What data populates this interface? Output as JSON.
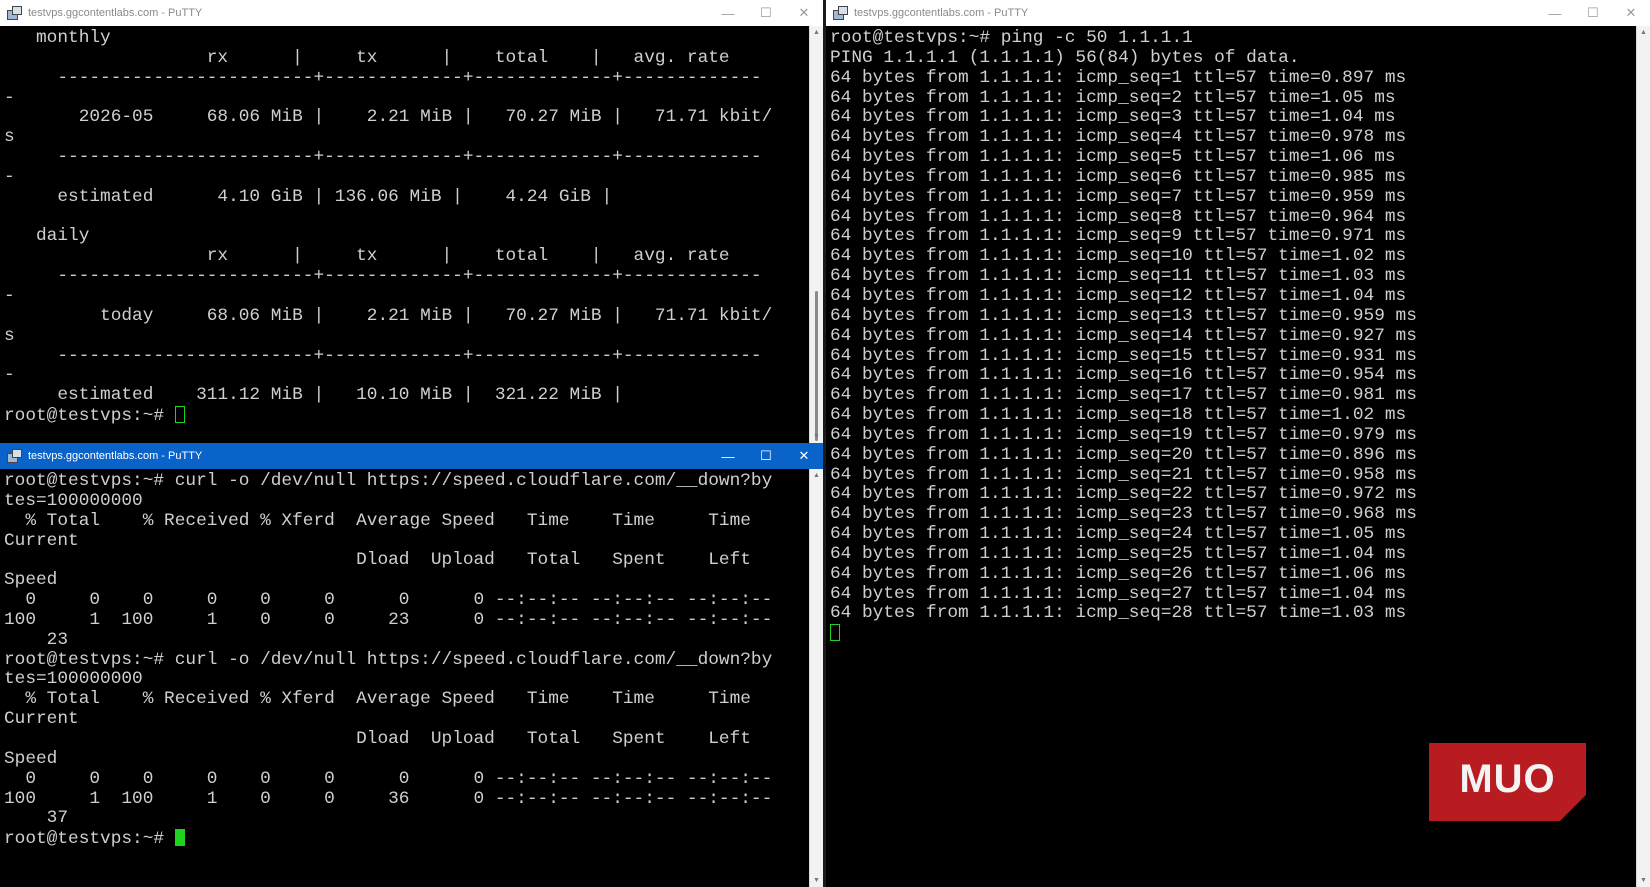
{
  "win_vnstat": {
    "title": "testvps.ggcontentlabs.com - PuTTY",
    "lines": [
      "   monthly",
      "                   rx      |     tx      |    total    |   avg. rate",
      "     ------------------------+-------------+-------------+-------------",
      "-",
      "       2026-05     68.06 MiB |    2.21 MiB |   70.27 MiB |   71.71 kbit/",
      "s",
      "     ------------------------+-------------+-------------+-------------",
      "-",
      "     estimated      4.10 GiB | 136.06 MiB |    4.24 GiB |",
      "",
      "   daily",
      "                   rx      |     tx      |    total    |   avg. rate",
      "     ------------------------+-------------+-------------+-------------",
      "-",
      "         today     68.06 MiB |    2.21 MiB |   70.27 MiB |   71.71 kbit/",
      "s",
      "     ------------------------+-------------+-------------+-------------",
      "-",
      "     estimated    311.12 MiB |   10.10 MiB |  321.22 MiB |"
    ],
    "prompt": "root@testvps:~# "
  },
  "win_curl": {
    "title": "testvps.ggcontentlabs.com - PuTTY",
    "lines": [
      "root@testvps:~# curl -o /dev/null https://speed.cloudflare.com/__down?by",
      "tes=100000000",
      "  % Total    % Received % Xferd  Average Speed   Time    Time     Time",
      "Current",
      "                                 Dload  Upload   Total   Spent    Left",
      "Speed",
      "  0     0    0     0    0     0      0      0 --:--:-- --:--:-- --:--:--",
      "100     1  100     1    0     0     23      0 --:--:-- --:--:-- --:--:--",
      "    23",
      "root@testvps:~# curl -o /dev/null https://speed.cloudflare.com/__down?by",
      "tes=100000000",
      "  % Total    % Received % Xferd  Average Speed   Time    Time     Time",
      "Current",
      "                                 Dload  Upload   Total   Spent    Left",
      "Speed",
      "  0     0    0     0    0     0      0      0 --:--:-- --:--:-- --:--:--",
      "100     1  100     1    0     0     36      0 --:--:-- --:--:-- --:--:--",
      "    37"
    ],
    "prompt": "root@testvps:~# "
  },
  "win_ping": {
    "title": "testvps.ggcontentlabs.com - PuTTY",
    "lines": [
      "root@testvps:~# ping -c 50 1.1.1.1",
      "PING 1.1.1.1 (1.1.1.1) 56(84) bytes of data.",
      "64 bytes from 1.1.1.1: icmp_seq=1 ttl=57 time=0.897 ms",
      "64 bytes from 1.1.1.1: icmp_seq=2 ttl=57 time=1.05 ms",
      "64 bytes from 1.1.1.1: icmp_seq=3 ttl=57 time=1.04 ms",
      "64 bytes from 1.1.1.1: icmp_seq=4 ttl=57 time=0.978 ms",
      "64 bytes from 1.1.1.1: icmp_seq=5 ttl=57 time=1.06 ms",
      "64 bytes from 1.1.1.1: icmp_seq=6 ttl=57 time=0.985 ms",
      "64 bytes from 1.1.1.1: icmp_seq=7 ttl=57 time=0.959 ms",
      "64 bytes from 1.1.1.1: icmp_seq=8 ttl=57 time=0.964 ms",
      "64 bytes from 1.1.1.1: icmp_seq=9 ttl=57 time=0.971 ms",
      "64 bytes from 1.1.1.1: icmp_seq=10 ttl=57 time=1.02 ms",
      "64 bytes from 1.1.1.1: icmp_seq=11 ttl=57 time=1.03 ms",
      "64 bytes from 1.1.1.1: icmp_seq=12 ttl=57 time=1.04 ms",
      "64 bytes from 1.1.1.1: icmp_seq=13 ttl=57 time=0.959 ms",
      "64 bytes from 1.1.1.1: icmp_seq=14 ttl=57 time=0.927 ms",
      "64 bytes from 1.1.1.1: icmp_seq=15 ttl=57 time=0.931 ms",
      "64 bytes from 1.1.1.1: icmp_seq=16 ttl=57 time=0.954 ms",
      "64 bytes from 1.1.1.1: icmp_seq=17 ttl=57 time=0.981 ms",
      "64 bytes from 1.1.1.1: icmp_seq=18 ttl=57 time=1.02 ms",
      "64 bytes from 1.1.1.1: icmp_seq=19 ttl=57 time=0.979 ms",
      "64 bytes from 1.1.1.1: icmp_seq=20 ttl=57 time=0.896 ms",
      "64 bytes from 1.1.1.1: icmp_seq=21 ttl=57 time=0.958 ms",
      "64 bytes from 1.1.1.1: icmp_seq=22 ttl=57 time=0.972 ms",
      "64 bytes from 1.1.1.1: icmp_seq=23 ttl=57 time=0.968 ms",
      "64 bytes from 1.1.1.1: icmp_seq=24 ttl=57 time=1.05 ms",
      "64 bytes from 1.1.1.1: icmp_seq=25 ttl=57 time=1.04 ms",
      "64 bytes from 1.1.1.1: icmp_seq=26 ttl=57 time=1.06 ms",
      "64 bytes from 1.1.1.1: icmp_seq=27 ttl=57 time=1.04 ms",
      "64 bytes from 1.1.1.1: icmp_seq=28 ttl=57 time=1.03 ms"
    ]
  },
  "window_controls": {
    "minimize": "—",
    "maximize": "☐",
    "close": "✕"
  },
  "watermark": "MUO",
  "colors": {
    "cursor": "#1ed31e",
    "active_titlebar": "#0a63c9",
    "logo": "#b81c21"
  },
  "icons": {
    "app": "putty-icon",
    "scroll_up": "scroll-up-arrow-icon",
    "scroll_down": "scroll-down-arrow-icon"
  }
}
